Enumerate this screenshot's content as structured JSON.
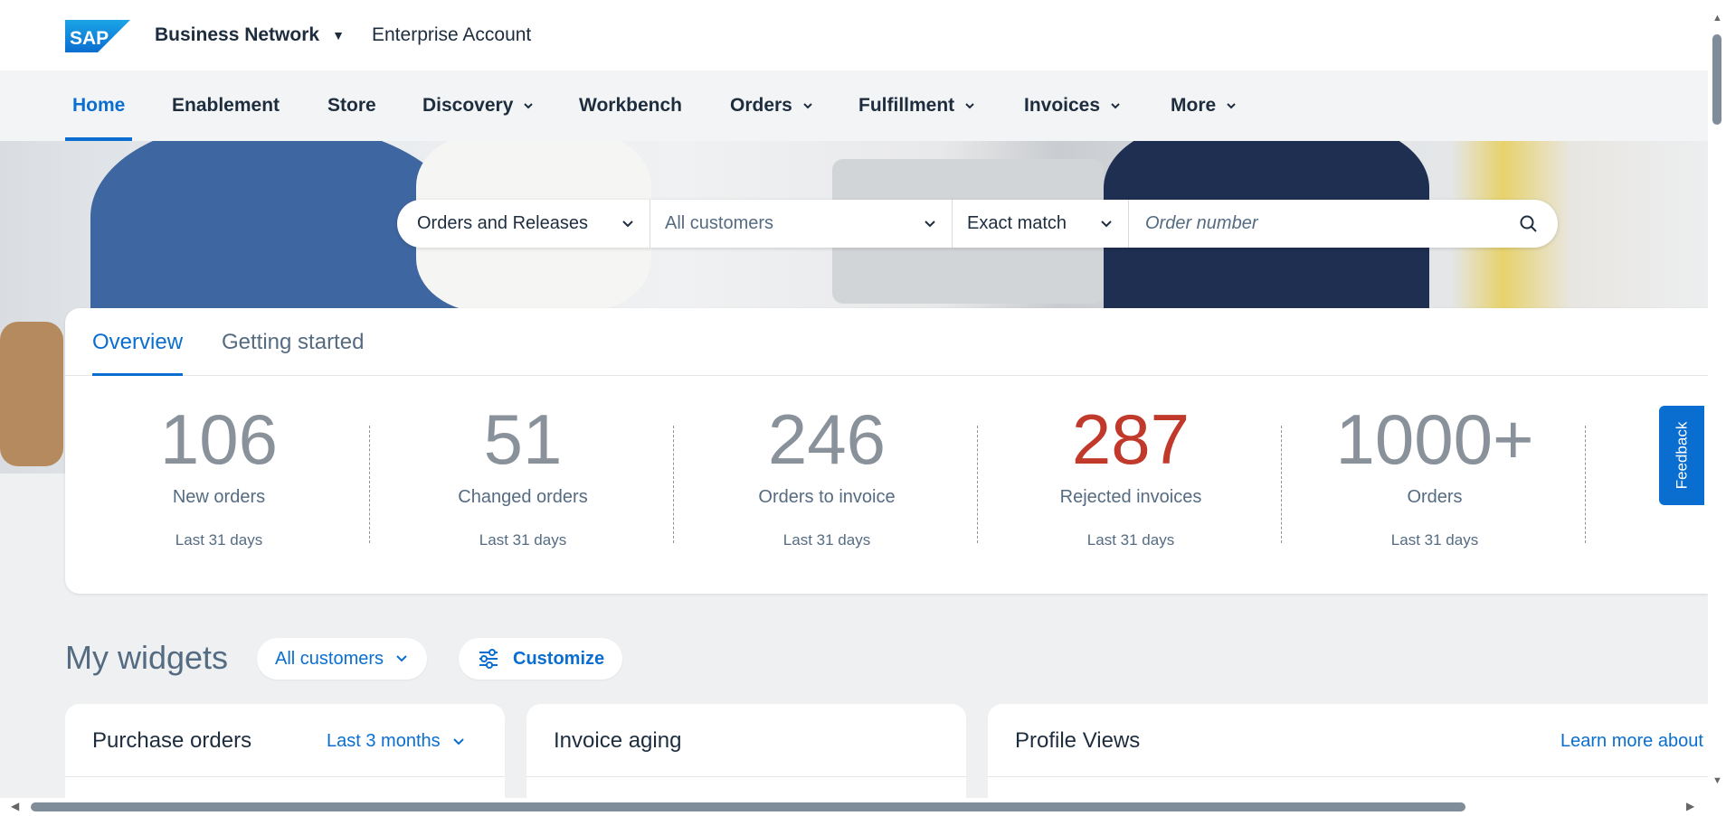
{
  "shell": {
    "logo_text": "SAP",
    "brand": "Business Network",
    "account": "Enterprise Account"
  },
  "nav": {
    "items": [
      {
        "label": "Home",
        "active": true,
        "has_menu": false
      },
      {
        "label": "Enablement",
        "has_menu": false
      },
      {
        "label": "Store",
        "has_menu": false
      },
      {
        "label": "Discovery",
        "has_menu": true
      },
      {
        "label": "Workbench",
        "has_menu": false
      },
      {
        "label": "Orders",
        "has_menu": true
      },
      {
        "label": "Fulfillment",
        "has_menu": true
      },
      {
        "label": "Invoices",
        "has_menu": true
      },
      {
        "label": "More",
        "has_menu": true
      }
    ]
  },
  "search": {
    "document_type": "Orders and Releases",
    "customer": "All customers",
    "match": "Exact match",
    "placeholder": "Order number"
  },
  "overview": {
    "tabs": [
      {
        "label": "Overview",
        "active": true
      },
      {
        "label": "Getting started"
      }
    ],
    "tiles": [
      {
        "value": "106",
        "label": "New orders",
        "period": "Last 31 days"
      },
      {
        "value": "51",
        "label": "Changed orders",
        "period": "Last 31 days"
      },
      {
        "value": "246",
        "label": "Orders to invoice",
        "period": "Last 31 days"
      },
      {
        "value": "287",
        "label": "Rejected invoices",
        "period": "Last 31 days",
        "color": "#c0392b"
      },
      {
        "value": "1000+",
        "label": "Orders",
        "period": "Last 31 days"
      }
    ]
  },
  "feedback": "Feedback",
  "widgets": {
    "title": "My widgets",
    "customer_filter": "All customers",
    "customize": "Customize",
    "cards": [
      {
        "title": "Purchase orders",
        "action": "Last 3 months"
      },
      {
        "title": "Invoice aging"
      },
      {
        "title": "Profile Views",
        "action": "Learn more about"
      }
    ]
  },
  "colors": {
    "accent": "#0a6ed1",
    "text": "#1d2d3e",
    "muted": "#556b82",
    "kpi": "#89919a",
    "alert": "#c0392b"
  }
}
